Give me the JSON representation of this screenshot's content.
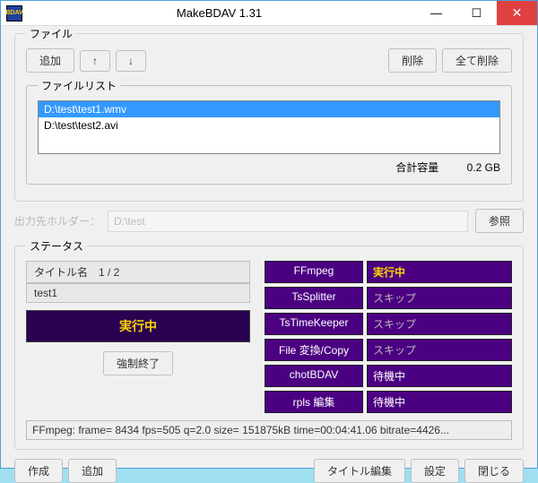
{
  "window": {
    "title": "MakeBDAV 1.31"
  },
  "file": {
    "legend": "ファイル",
    "btn_add": "追加",
    "btn_up": "↑",
    "btn_down": "↓",
    "btn_delete": "削除",
    "btn_delete_all": "全て削除",
    "list_legend": "ファイルリスト",
    "items": [
      {
        "path": "D:\\test\\test1.wmv",
        "selected": true
      },
      {
        "path": "D:\\test\\test2.avi",
        "selected": false
      }
    ],
    "total_label": "合計容量",
    "total_value": "0.2 GB"
  },
  "output": {
    "label": "出力先ホルダー：",
    "value": "D:\\test",
    "browse": "参照"
  },
  "status": {
    "legend": "ステータス",
    "title_header": "タイトル名　1 / 2",
    "title_name": "test1",
    "progress_text": "実行中",
    "abort": "強制終了",
    "stages": [
      {
        "name": "FFmpeg",
        "value": "実行中",
        "cls": "running"
      },
      {
        "name": "TsSplitter",
        "value": "スキップ",
        "cls": "skip"
      },
      {
        "name": "TsTimeKeeper",
        "value": "スキップ",
        "cls": "skip"
      },
      {
        "name": "File 変換/Copy",
        "value": "スキップ",
        "cls": "skip"
      },
      {
        "name": "chotBDAV",
        "value": "待機中",
        "cls": ""
      },
      {
        "name": "rpls 編集",
        "value": "待機中",
        "cls": ""
      }
    ],
    "log": "FFmpeg: frame= 8434 fps=505 q=2.0 size= 151875kB time=00:04:41.06 bitrate=4426..."
  },
  "bottom": {
    "create": "作成",
    "add": "追加",
    "title_edit": "タイトル編集",
    "settings": "設定",
    "close": "閉じる"
  }
}
